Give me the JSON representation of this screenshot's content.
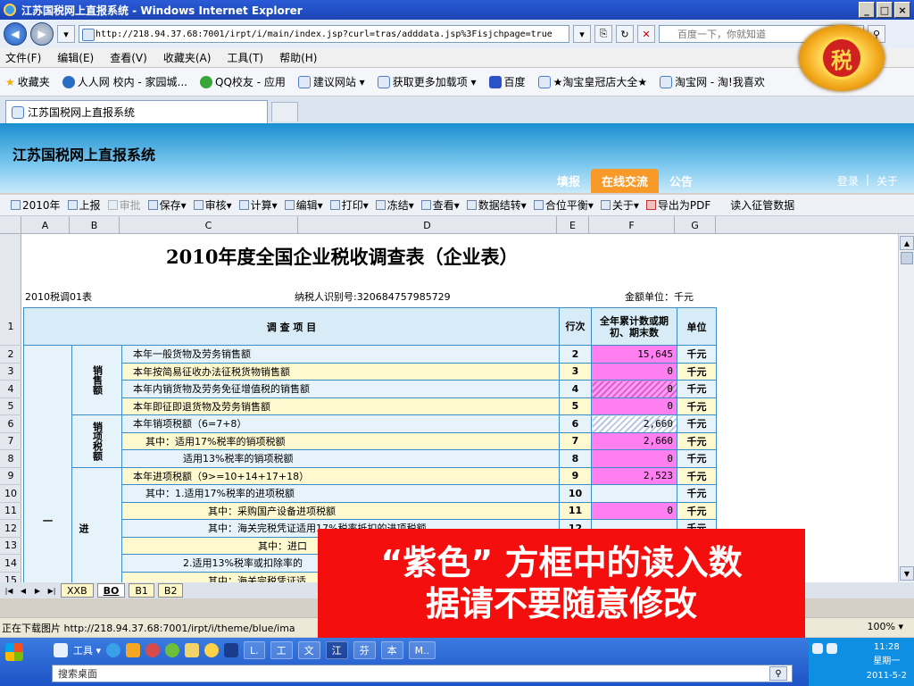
{
  "window": {
    "title": "江苏国税网上直报系统 - Windows Internet Explorer",
    "controls": [
      "_",
      "□",
      "×"
    ]
  },
  "addressbar": {
    "url": "http://218.94.37.68:7001/irpt/i/main/index.jsp?curl=tras/adddata.jsp%3Fisjchpage=true",
    "search_placeholder": "百度一下，你就知道"
  },
  "menubar": {
    "items": [
      "文件(F)",
      "编辑(E)",
      "查看(V)",
      "收藏夹(A)",
      "工具(T)",
      "帮助(H)"
    ]
  },
  "favorites": {
    "label": "收藏夹",
    "items": [
      "人人网 校内 - 家园城...",
      "QQ校友 - 应用",
      "建议网站 ▾",
      "获取更多加载项 ▾",
      "百度",
      "★淘宝皇冠店大全★",
      "淘宝网 - 淘!我喜欢"
    ]
  },
  "tab": {
    "label": "江苏国税网上直报系统"
  },
  "app": {
    "title": "江苏国税网上直报系统",
    "nav": [
      "填报",
      "在线交流",
      "公告"
    ],
    "active_nav": "在线交流",
    "top_links": [
      "登录",
      "|",
      "关于"
    ],
    "emblem_char": "税"
  },
  "toolbar": {
    "items": [
      {
        "label": "2010年",
        "disabled": false
      },
      {
        "label": "上报",
        "disabled": false
      },
      {
        "label": "审批",
        "disabled": true
      },
      {
        "label": "保存▾",
        "disabled": false
      },
      {
        "label": "审核▾",
        "disabled": false
      },
      {
        "label": "计算▾",
        "disabled": false
      },
      {
        "label": "编辑▾",
        "disabled": false
      },
      {
        "label": "打印▾",
        "disabled": false
      },
      {
        "label": "冻结▾",
        "disabled": false
      },
      {
        "label": "查看▾",
        "disabled": false
      },
      {
        "label": "数据结转▾",
        "disabled": false
      },
      {
        "label": "合位平衡▾",
        "disabled": false
      },
      {
        "label": "关于▾",
        "disabled": false
      },
      {
        "label": "导出为PDF",
        "disabled": false
      },
      {
        "label": "读入征管数据",
        "disabled": false
      }
    ]
  },
  "columns": [
    "A",
    "B",
    "C",
    "D",
    "E",
    "F",
    "G"
  ],
  "sheet": {
    "title": "2010年度全国企业税收调查表（企业表）",
    "form_code": "2010税调01表",
    "taxpayer_id": "纳税人识别号:320684757985729",
    "unit_label": "金额单位：千元",
    "header": {
      "item": "调 查 项 目",
      "lineno": "行次",
      "amount": "全年累计数或期初、期末数",
      "unit": "单位"
    },
    "categories": [
      {
        "label": "销售额"
      },
      {
        "label": "销项税额"
      },
      {
        "label": "进"
      }
    ],
    "first_col_label": "一",
    "rows": [
      {
        "rownum": "2",
        "item": "本年一般货物及劳务销售额",
        "lineno": "2",
        "value": "15,645",
        "unit": "千元",
        "fill": "pink"
      },
      {
        "rownum": "3",
        "item": "本年按简易征收办法征税货物销售额",
        "lineno": "3",
        "value": "0",
        "unit": "千元",
        "fill": "pink"
      },
      {
        "rownum": "4",
        "item": "本年内销货物及劳务免征增值税的销售额",
        "lineno": "4",
        "value": "0",
        "unit": "千元",
        "fill": "pinkhatch"
      },
      {
        "rownum": "5",
        "item": "本年即征即退货物及劳务销售额",
        "lineno": "5",
        "value": "0",
        "unit": "千元",
        "fill": "pink"
      },
      {
        "rownum": "6",
        "item": "本年销项税额（6=7+8）",
        "lineno": "6",
        "value": "2,660",
        "unit": "千元",
        "fill": "hatch"
      },
      {
        "rownum": "7",
        "item": "其中：适用17%税率的销项税额",
        "lineno": "7",
        "value": "2,660",
        "unit": "千元",
        "fill": "pink"
      },
      {
        "rownum": "8",
        "item": "适用13%税率的销项税额",
        "lineno": "8",
        "value": "0",
        "unit": "千元",
        "fill": "pink"
      },
      {
        "rownum": "9",
        "item": "本年进项税额（9>=10+14+17+18）",
        "lineno": "9",
        "value": "2,523",
        "unit": "千元",
        "fill": "pink"
      },
      {
        "rownum": "10",
        "item": "其中：1.适用17%税率的进项税额",
        "lineno": "10",
        "value": "",
        "unit": "千元",
        "fill": "none"
      },
      {
        "rownum": "11",
        "item": "其中：采购国产设备进项税额",
        "lineno": "11",
        "value": "0",
        "unit": "千元",
        "fill": "pink"
      },
      {
        "rownum": "12",
        "item": "其中：海关完税凭证适用17%税率抵扣的进项税额",
        "lineno": "12",
        "value": "",
        "unit": "千元",
        "fill": "none"
      },
      {
        "rownum": "13",
        "item": "其中：进口",
        "lineno": "13",
        "value": "",
        "unit": "千元",
        "fill": "none"
      },
      {
        "rownum": "14",
        "item": "2.适用13%税率或扣除率的",
        "lineno": "14",
        "value": "",
        "unit": "千元",
        "fill": "none"
      },
      {
        "rownum": "15",
        "item": "其中：海关完税凭证适",
        "lineno": "15",
        "value": "",
        "unit": "千元",
        "fill": "none"
      }
    ]
  },
  "sheet_tabs": [
    "XXB",
    "BO",
    "B1",
    "B2"
  ],
  "active_sheet_tab": "BO",
  "status": {
    "text": "正在下载图片 http://218.94.37.68:7001/irpt/i/theme/blue/ima",
    "zoom": "100% ▾"
  },
  "overlay": {
    "line1": "“紫色” 方框中的读入数",
    "line2": "据请不要随意修改"
  },
  "taskbar": {
    "tools_label": "工具 ▾",
    "search_placeholder": "搜索桌面",
    "buttons": [
      "L.",
      "工",
      "文",
      "江",
      "芬",
      "本",
      "M.."
    ],
    "clock_time": "11:28",
    "clock_day": "星期一",
    "clock_date": "2011-5-2"
  },
  "colors": {
    "pink": "#ff7ff0",
    "overlay_red": "#f40e0e",
    "active_nav": "#f79a2a",
    "grid_border": "#3c8cc9"
  }
}
